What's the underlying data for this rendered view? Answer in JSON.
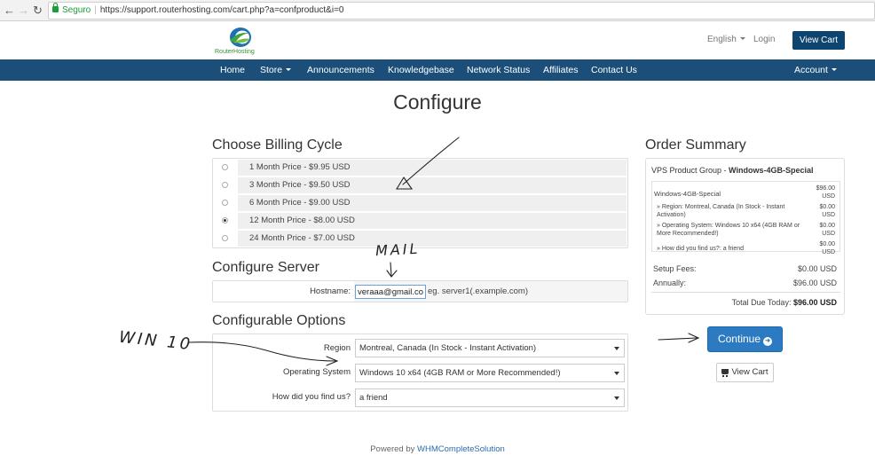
{
  "browser": {
    "secure_label": "Seguro",
    "separator": "|",
    "url": "https://support.routerhosting.com/cart.php?a=confproduct&i=0",
    "back_icon": "back-arrow-icon",
    "forward_icon": "forward-arrow-icon",
    "reload_icon": "reload-icon"
  },
  "header": {
    "logo_text": "RouterHosting",
    "language": "English",
    "login": "Login",
    "view_cart": "View Cart"
  },
  "nav": {
    "items": [
      "Home",
      "Store",
      "Announcements",
      "Knowledgebase",
      "Network Status",
      "Affiliates",
      "Contact Us"
    ],
    "account": "Account"
  },
  "page_title": "Configure",
  "billing": {
    "heading": "Choose Billing Cycle",
    "options": [
      {
        "label": "1 Month Price - $9.95 USD",
        "selected": false
      },
      {
        "label": "3 Month Price - $9.50 USD",
        "selected": false
      },
      {
        "label": "6 Month Price - $9.00 USD",
        "selected": false
      },
      {
        "label": "12 Month Price - $8.00 USD",
        "selected": true
      },
      {
        "label": "24 Month Price - $7.00 USD",
        "selected": false
      }
    ]
  },
  "server": {
    "heading": "Configure Server",
    "hostname_label": "Hostname:",
    "hostname_value": "veraaa@gmail.com",
    "hostname_hint": "eg. server1(.example.com)"
  },
  "options": {
    "heading": "Configurable Options",
    "region_label": "Region",
    "region_value": "Montreal, Canada (In Stock - Instant Activation)",
    "os_label": "Operating System",
    "os_value": "Windows 10 x64 (4GB RAM or More Recommended!)",
    "find_label": "How did you find us?",
    "find_value": "a friend"
  },
  "summary": {
    "heading": "Order Summary",
    "group_prefix": "VPS Product Group - ",
    "group_name": "Windows-4GB-Special",
    "product": "Windows-4GB-Special",
    "product_price_1": "$96.00",
    "product_price_2": "USD",
    "lines": [
      {
        "text_1": "» Region: Montreal, Canada (In Stock - Instant",
        "text_2": "Activation)",
        "price_1": "$0.00",
        "price_2": "USD"
      },
      {
        "text_1": "» Operating System: Windows 10 x64 (4GB RAM or",
        "text_2": "More Recommended!)",
        "price_1": "$0.00",
        "price_2": "USD"
      },
      {
        "text_1": "» How did you find us?: a friend",
        "text_2": "",
        "price_1": "$0.00",
        "price_2": "USD"
      }
    ],
    "setup_label": "Setup Fees:",
    "setup_value": "$0.00 USD",
    "annual_label": "Annually:",
    "annual_value": "$96.00 USD",
    "total_label": "Total Due Today:",
    "total_value": "$96.00 USD",
    "continue": "Continue",
    "continue_icon": "arrow-circle-right-icon",
    "view_cart": "View Cart",
    "cart_icon": "shopping-cart-icon"
  },
  "footer": {
    "prefix": "Powered by",
    "link": "WHMCompleteSolution"
  },
  "annotations": {
    "mail": "MAIL",
    "win10": "WIN 10"
  }
}
